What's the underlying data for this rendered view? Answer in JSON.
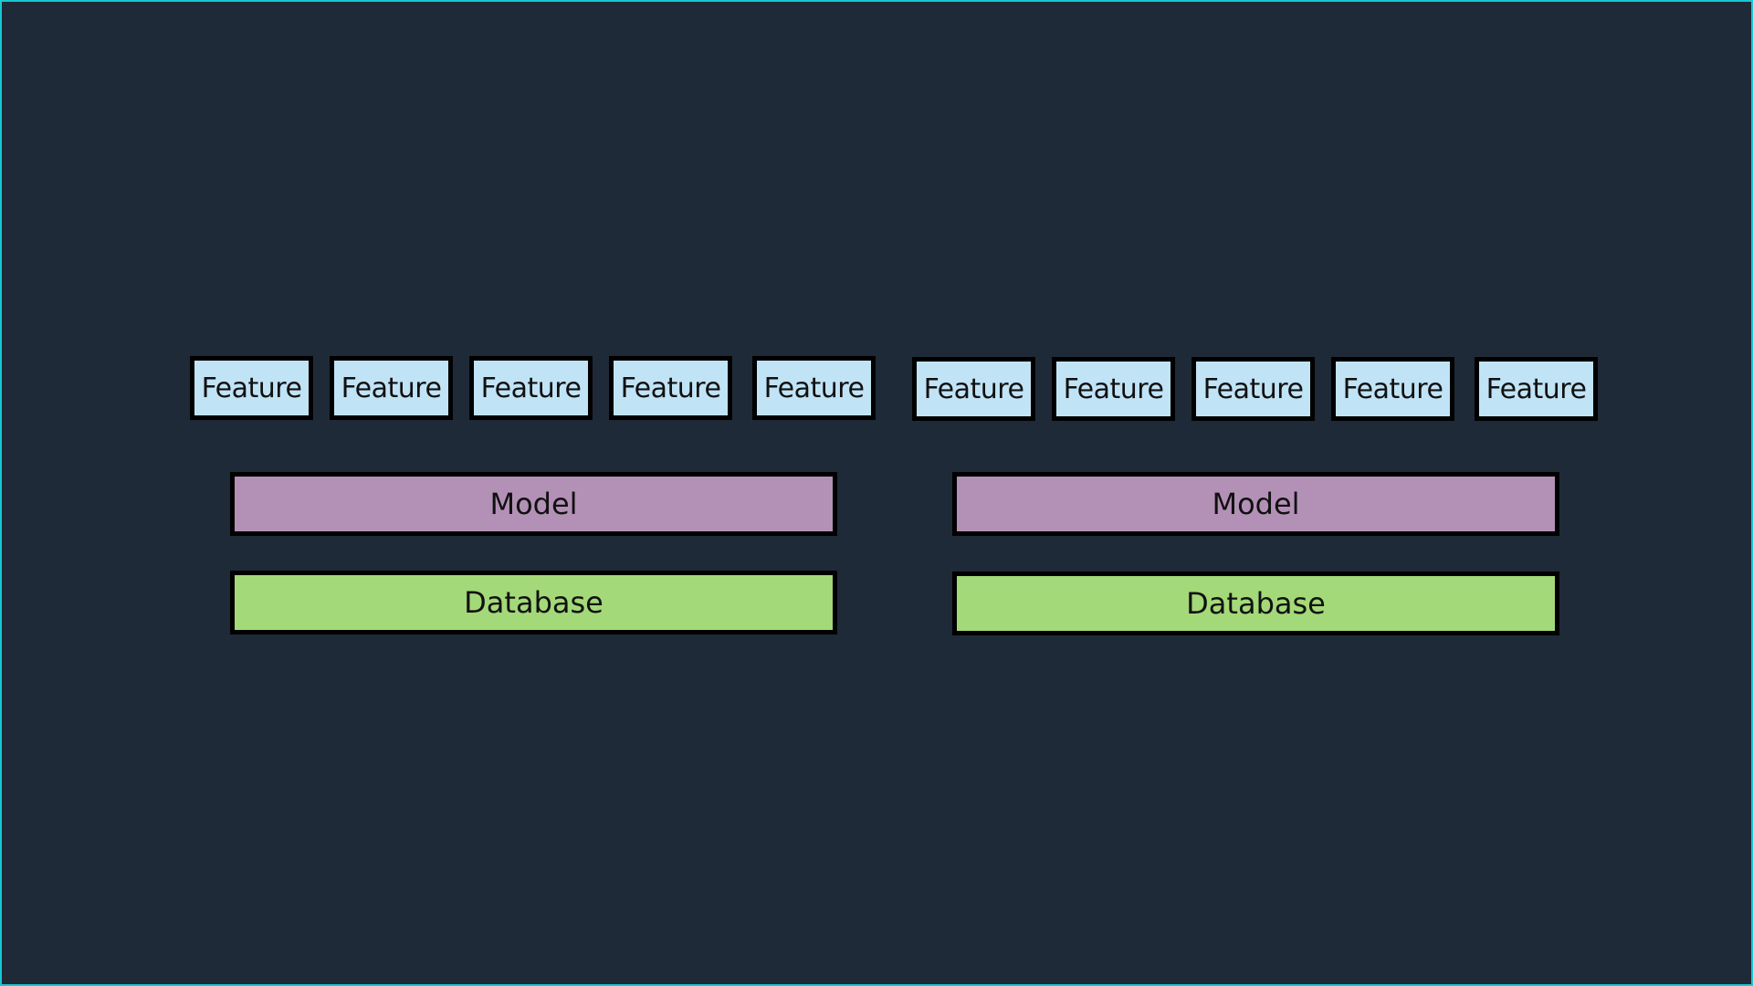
{
  "stacks": [
    {
      "features": [
        "Feature",
        "Feature",
        "Feature",
        "Feature",
        "Feature"
      ],
      "model": "Model",
      "database": "Database"
    },
    {
      "features": [
        "Feature",
        "Feature",
        "Feature",
        "Feature",
        "Feature"
      ],
      "model": "Model",
      "database": "Database"
    }
  ],
  "colors": {
    "background": "#1f2a38",
    "feature_fill": "#c1e3f6",
    "model_fill": "#b391b6",
    "database_fill": "#a3d978",
    "outline": "#000000",
    "frame": "#19c6d1"
  }
}
